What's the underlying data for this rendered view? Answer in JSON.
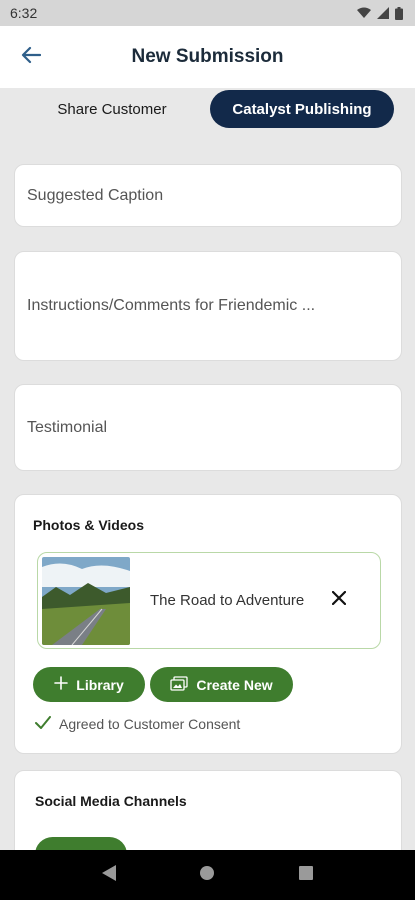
{
  "status_bar": {
    "time": "6:32"
  },
  "header": {
    "title": "New Submission"
  },
  "tabs": [
    {
      "label": "Share Customer",
      "active": false
    },
    {
      "label": "Catalyst Publishing",
      "active": true
    }
  ],
  "fields": {
    "caption_placeholder": "Suggested Caption",
    "instructions_placeholder": "Instructions/Comments for Friendemic ...",
    "testimonial_placeholder": "Testimonial"
  },
  "media": {
    "section_title": "Photos & Videos",
    "items": [
      {
        "title": "The Road to Adventure"
      }
    ],
    "library_label": "Library",
    "create_new_label": "Create New",
    "consent_label": "Agreed to Customer Consent"
  },
  "social": {
    "section_title": "Social Media Channels"
  },
  "colors": {
    "accent_green": "#3f7d2e",
    "navy": "#12294a",
    "title": "#1c2b3a"
  },
  "icons": [
    "back-arrow-icon",
    "wifi-icon",
    "signal-icon",
    "battery-icon",
    "close-icon",
    "plus-icon",
    "gallery-icon",
    "check-icon",
    "nav-back-icon",
    "nav-home-icon",
    "nav-recents-icon"
  ]
}
